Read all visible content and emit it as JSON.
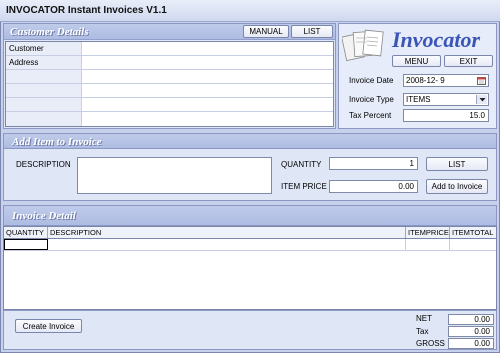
{
  "window": {
    "title": "INVOCATOR Instant Invoices V1.1"
  },
  "customer": {
    "section_title": "Customer Details",
    "manual_label": "MANUAL",
    "list_label": "LIST",
    "rows": [
      {
        "label": "Customer",
        "value": ""
      },
      {
        "label": "Address",
        "value": ""
      },
      {
        "label": "",
        "value": ""
      },
      {
        "label": "",
        "value": ""
      },
      {
        "label": "",
        "value": ""
      },
      {
        "label": "",
        "value": ""
      }
    ]
  },
  "brand": {
    "logo_text": "Invocator",
    "menu_label": "MENU",
    "exit_label": "EXIT",
    "invoice_date_label": "Invoice Date",
    "invoice_date_value": "2008-12- 9",
    "invoice_type_label": "Invoice Type",
    "invoice_type_value": "ITEMS",
    "tax_percent_label": "Tax Percent",
    "tax_percent_value": "15.0"
  },
  "add_item": {
    "section_title": "Add Item to Invoice",
    "description_label": "DESCRIPTION",
    "quantity_label": "QUANTITY",
    "quantity_value": "1",
    "item_price_label": "ITEM PRICE",
    "item_price_value": "0.00",
    "list_label": "LIST",
    "add_label": "Add to Invoice"
  },
  "detail": {
    "section_title": "Invoice Detail",
    "columns": [
      "QUANTITY",
      "DESCRIPTION",
      "ITEMPRICE",
      "ITEMTOTAL"
    ]
  },
  "footer": {
    "create_label": "Create Invoice",
    "net_label": "NET",
    "net_value": "0.00",
    "tax_label": "Tax",
    "tax_value": "0.00",
    "gross_label": "GROSS",
    "gross_value": "0.00"
  },
  "colors": {
    "section_bg": "#aebce3",
    "panel_bg": "#dfe6f6",
    "accent_blue": "#3a55b5"
  },
  "icons": {
    "calendar": "calendar-icon",
    "dropdown": "chevron-down-icon",
    "logo": "invoice-documents-icon"
  }
}
